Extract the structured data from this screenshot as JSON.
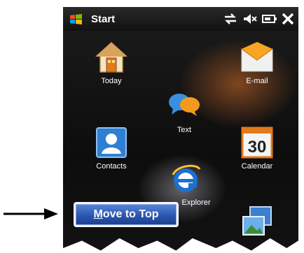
{
  "statusbar": {
    "title": "Start",
    "icons": [
      "windows-logo",
      "network-icon",
      "volume-muted-icon",
      "battery-icon",
      "close-icon"
    ]
  },
  "tiles": [
    {
      "label": "Today",
      "icon": "house-icon"
    },
    {
      "label": "E-mail",
      "icon": "envelope-icon"
    },
    {
      "label": "Text",
      "icon": "chat-bubbles-icon"
    },
    {
      "label": "Contacts",
      "icon": "contact-card-icon"
    },
    {
      "label": "Calendar",
      "icon": "calendar-icon",
      "day": "30"
    },
    {
      "label": "Explorer",
      "icon": "internet-explorer-icon"
    },
    {
      "label": "",
      "icon": "pictures-videos-icon"
    }
  ],
  "context_menu": {
    "move_to_top_first": "M",
    "move_to_top_rest": "ove to Top"
  },
  "annotation": {
    "arrow": "arrow-pointer"
  }
}
